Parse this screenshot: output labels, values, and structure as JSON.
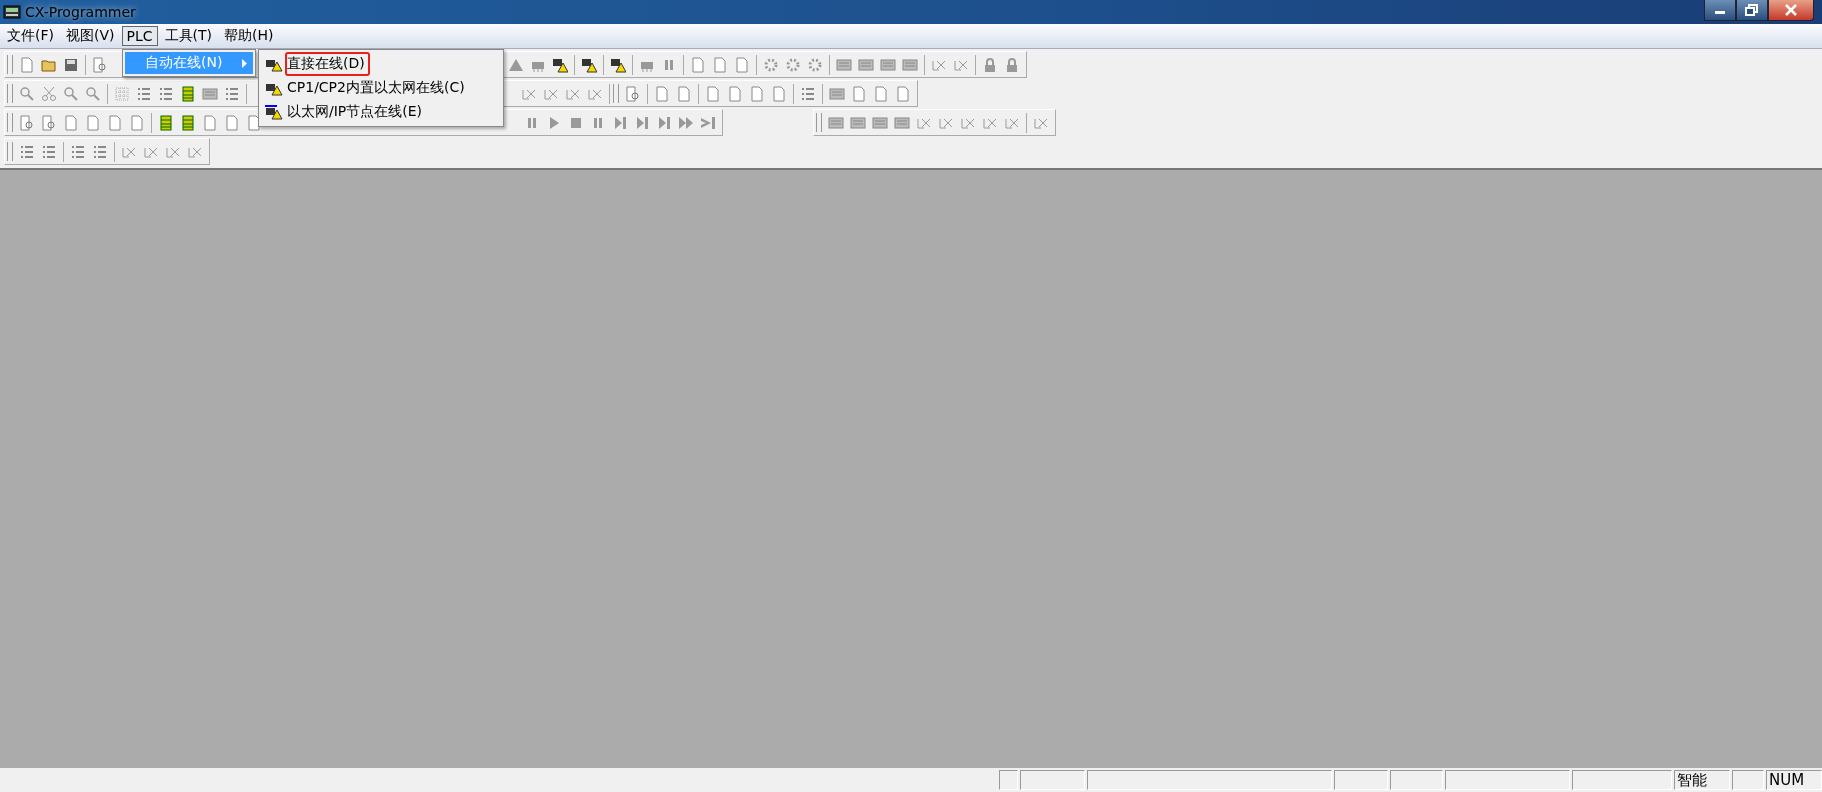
{
  "window": {
    "title": "CX-Programmer"
  },
  "menu_bar": [
    {
      "label": "文件(F)",
      "selected": false
    },
    {
      "label": "视图(V)",
      "selected": false
    },
    {
      "label": "PLC",
      "selected": true
    },
    {
      "label": "工具(T)",
      "selected": false
    },
    {
      "label": "帮助(H)",
      "selected": false
    }
  ],
  "dropdown": {
    "items": [
      {
        "label": "自动在线(N)",
        "selected": true,
        "has_submenu": true
      }
    ]
  },
  "submenu": {
    "items": [
      {
        "label": "直接在线(D)",
        "outlined": true
      },
      {
        "label": "CP1/CP2内置以太网在线(C)",
        "outlined": false
      },
      {
        "label": "以太网/IP节点在线(E)",
        "outlined": false
      }
    ]
  },
  "status_bar": {
    "mode": "智能",
    "keyboard": "NUM"
  }
}
